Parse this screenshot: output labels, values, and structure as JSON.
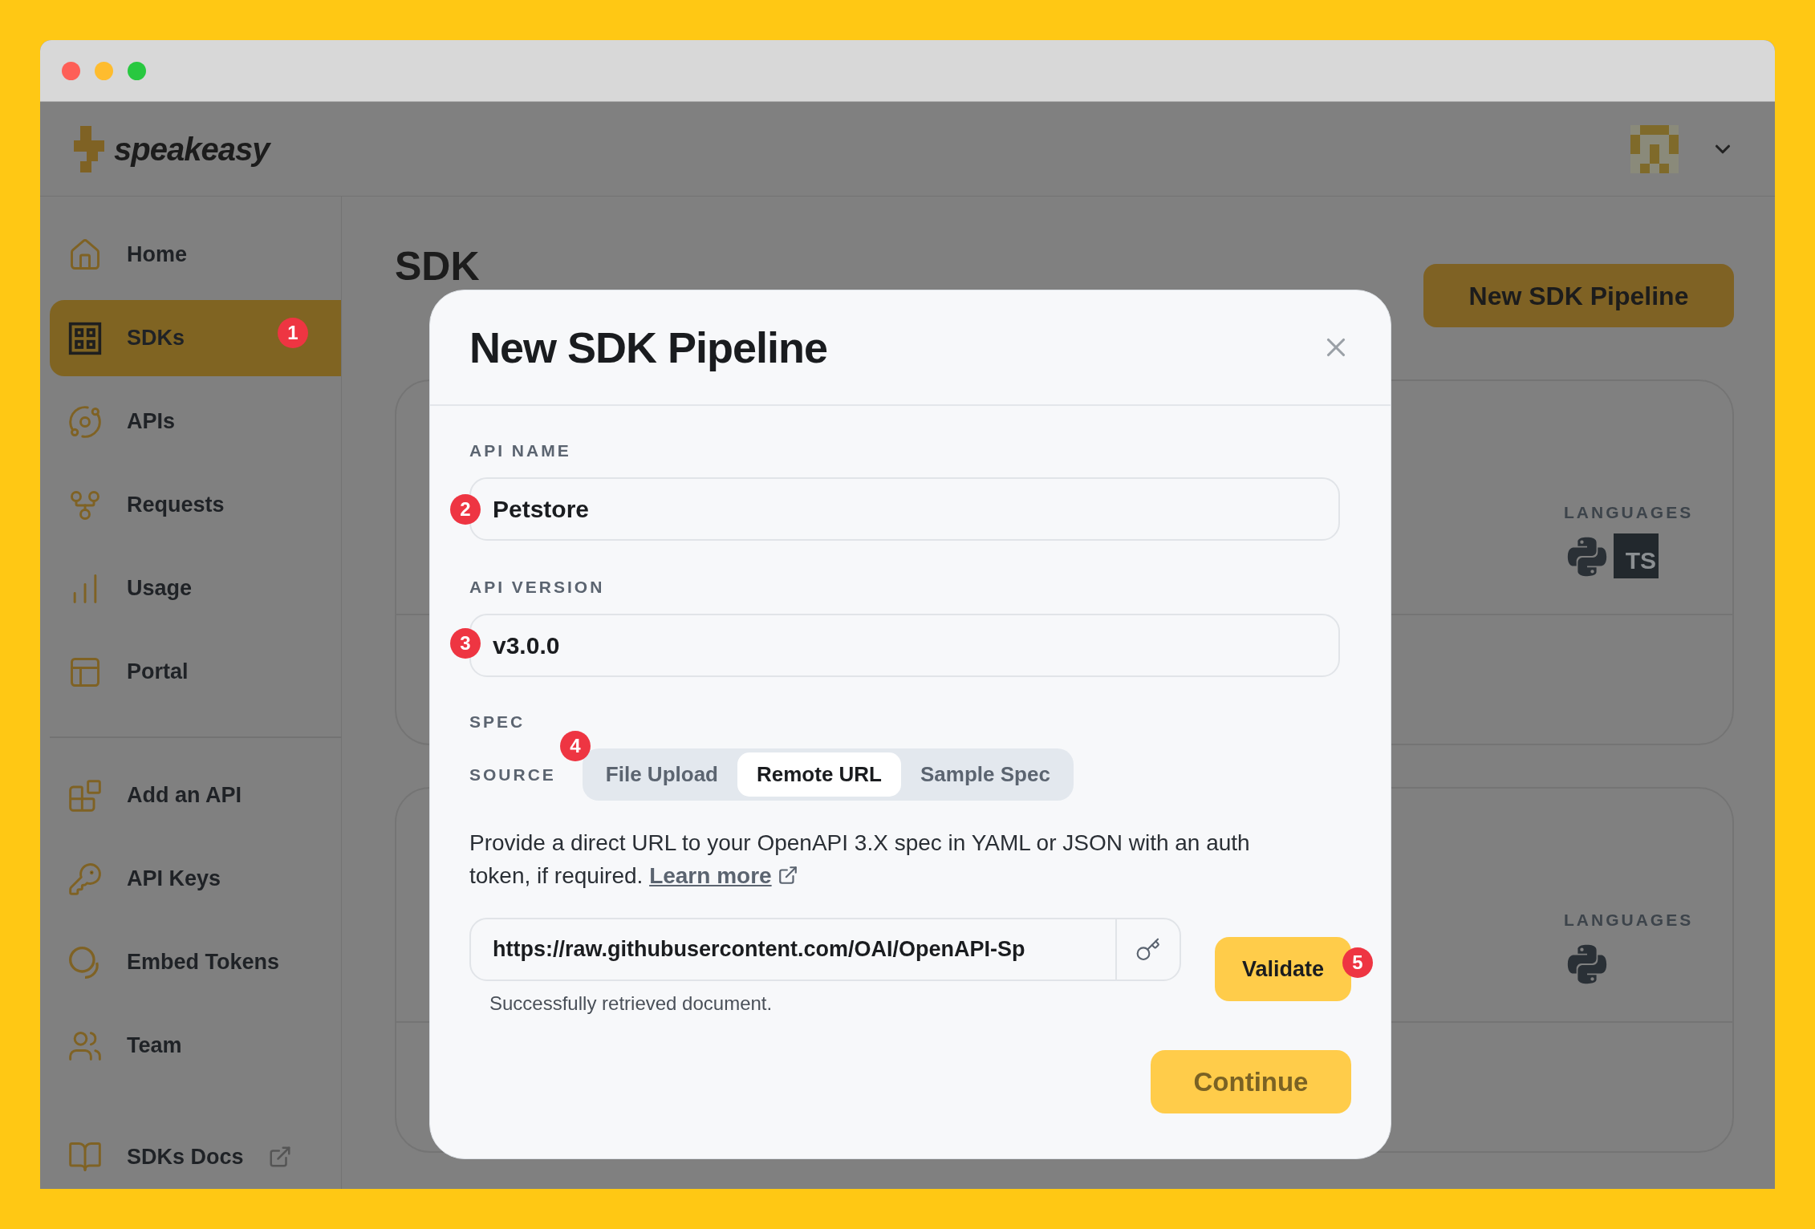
{
  "header": {
    "logo_text": "speakeasy"
  },
  "sidebar": {
    "items": [
      {
        "label": "Home",
        "selected": false
      },
      {
        "label": "SDKs",
        "selected": true,
        "badge": "1"
      },
      {
        "label": "APIs",
        "selected": false
      },
      {
        "label": "Requests",
        "selected": false
      },
      {
        "label": "Usage",
        "selected": false
      },
      {
        "label": "Portal",
        "selected": false
      }
    ],
    "bottom_items": [
      {
        "label": "Add an API",
        "selected": false
      },
      {
        "label": "API Keys",
        "selected": false
      },
      {
        "label": "Embed Tokens",
        "selected": false
      },
      {
        "label": "Team",
        "selected": false
      }
    ],
    "docs_link": "SDKs Docs"
  },
  "page": {
    "title": "SDK",
    "primary_button": "New SDK Pipeline",
    "cards": [
      {
        "languages_label": "LANGUAGES",
        "languages": [
          {
            "kind": "python"
          },
          {
            "kind": "typescript",
            "label": "TS"
          }
        ]
      },
      {
        "languages_label": "LANGUAGES",
        "languages": [
          {
            "kind": "python"
          }
        ]
      }
    ]
  },
  "modal": {
    "title": "New SDK Pipeline",
    "fields": [
      {
        "label": "API NAME",
        "value": "Petstore",
        "badge": "2"
      },
      {
        "label": "API VERSION",
        "value": "v3.0.0",
        "badge": "3"
      }
    ],
    "spec_label": "SPEC",
    "source_label": "SOURCE",
    "source_badge": "4",
    "source_tabs": [
      {
        "label": "File Upload",
        "selected": false
      },
      {
        "label": "Remote URL",
        "selected": true
      },
      {
        "label": "Sample Spec",
        "selected": false
      }
    ],
    "description": "Provide a direct URL to your OpenAPI 3.X spec in YAML or JSON with an auth token, if required.",
    "learn_more": "Learn more",
    "url_value": "https://raw.githubusercontent.com/OAI/OpenAPI-Sp",
    "status": "Successfully retrieved document.",
    "validate_button": "Validate",
    "validate_badge": "5",
    "continue_button": "Continue"
  }
}
